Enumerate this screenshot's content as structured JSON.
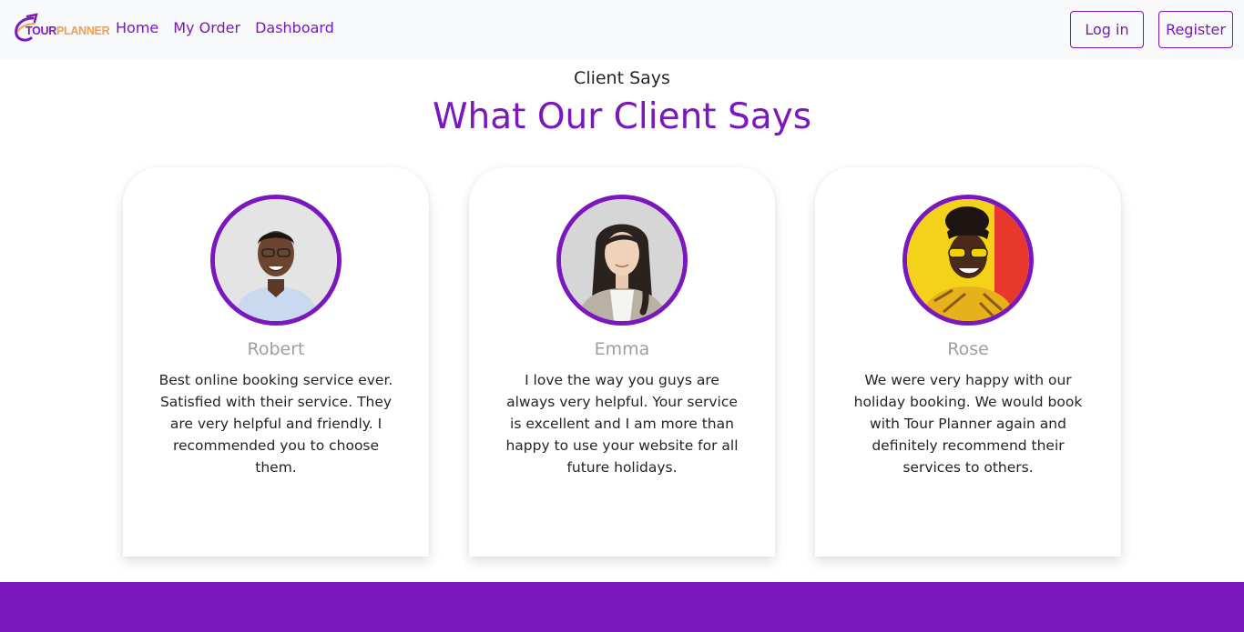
{
  "brand": {
    "part1": "TOUR",
    "part2": "PLANNER"
  },
  "nav": {
    "links": [
      "Home",
      "My Order",
      "Dashboard"
    ]
  },
  "auth": {
    "login_label": "Log in",
    "register_label": "Register"
  },
  "section": {
    "subtitle": "Client Says",
    "title": "What Our Client Says"
  },
  "testimonials": [
    {
      "name": "Robert",
      "text": "Best online booking service ever. Satisfied with their service. They are very helpful and friendly. I recommended you to choose them."
    },
    {
      "name": "Emma",
      "text": "I love the way you guys are always very helpful. Your service is excellent and I am more than happy to use your website for all future holidays."
    },
    {
      "name": "Rose",
      "text": "We were very happy with our holiday booking. We would book with Tour Planner again and definitely recommend their services to others."
    }
  ],
  "colors": {
    "accent": "#7a17bd",
    "navbar_bg": "#f8f9fa",
    "name_gray": "#9e9e9e",
    "logo_orange": "#f0a050"
  },
  "icons": {
    "logo": "tour-planner-logo"
  }
}
